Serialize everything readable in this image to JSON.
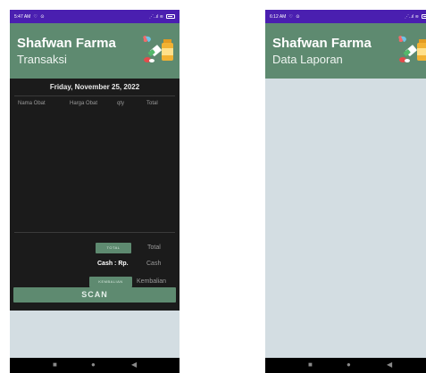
{
  "left_phone": {
    "status_bar": {
      "time": "5:47 AM",
      "icons": "♡ ⊙",
      "signal": "⋰..ıl ≋"
    },
    "app_title": "Shafwan Farma",
    "screen_subtitle": "Transaksi",
    "date": "Friday, November 25, 2022",
    "table_headers": [
      "Nama Obat",
      "Harga Obat",
      "qty",
      "Total"
    ],
    "total_button": "TOTAL",
    "total_label": "Total",
    "cash_label": "Cash :  Rp.",
    "cash_value_placeholder": "Cash",
    "kembalian_button": "KEMBALIAN",
    "kembalian_label": "Kembalian",
    "scan_button": "SCAN"
  },
  "right_phone": {
    "status_bar": {
      "time": "6:12 AM",
      "icons": "♡ ⊙",
      "signal": "⋰..ıl ≋"
    },
    "app_title": "Shafwan Farma",
    "screen_subtitle": "Data Laporan"
  },
  "nav_icons": {
    "recents": "recents-icon",
    "home": "home-icon",
    "back": "back-icon"
  },
  "colors": {
    "status_bar": "#4a1fb0",
    "app_bar": "#5e8a70",
    "dark_panel": "#1b1b1b",
    "light_panel": "#d3dde2",
    "nav_bar": "#000000"
  }
}
